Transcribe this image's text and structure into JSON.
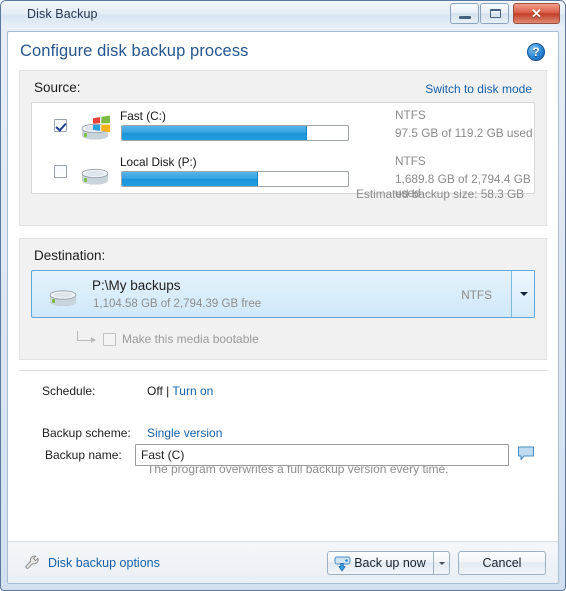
{
  "window": {
    "title": "Disk Backup",
    "buttons": {
      "minimize": "minimize-button",
      "maximize": "maximize-button",
      "close_glyph": "✕"
    }
  },
  "header": {
    "title": "Configure disk backup process",
    "help_glyph": "?"
  },
  "source": {
    "label": "Source:",
    "switch_link": "Switch to disk mode",
    "disks": [
      {
        "name": "Fast (C:)",
        "filesystem": "NTFS",
        "usage": "97.5 GB of 119.2 GB used",
        "checked": true,
        "percent_used": 82,
        "icon": "system-disk-icon"
      },
      {
        "name": "Local Disk (P:)",
        "filesystem": "NTFS",
        "usage": "1,689.8 GB of 2,794.4 GB used",
        "checked": false,
        "percent_used": 60,
        "icon": "disk-icon"
      }
    ],
    "estimated": "Estimated backup size: 58.3 GB"
  },
  "destination": {
    "label": "Destination:",
    "path": "P:\\My backups",
    "free": "1,104.58 GB of 2,794.39 GB free",
    "filesystem": "NTFS",
    "bootable_label": "Make this media bootable",
    "bootable_checked": false,
    "bootable_enabled": false
  },
  "options": {
    "schedule_label": "Schedule:",
    "schedule_state": "Off",
    "schedule_separator": "|",
    "schedule_link": "Turn on",
    "scheme_label": "Backup scheme:",
    "scheme_link": "Single version",
    "scheme_desc": "The program overwrites a full backup version every time.",
    "backup_name_label": "Backup name:",
    "backup_name_value": "Fast (C)",
    "backup_name_placeholder": "Backup name",
    "comment_icon": "comment-icon"
  },
  "footer": {
    "options_link": "Disk backup options",
    "backup_now": "Back up now",
    "cancel": "Cancel"
  },
  "colors": {
    "accent_link": "#1560a8",
    "title_blue": "#25568f",
    "bar_fill": "#1c93d8",
    "selection_bg": "#cfe8f9",
    "close_red": "#c23f28"
  }
}
